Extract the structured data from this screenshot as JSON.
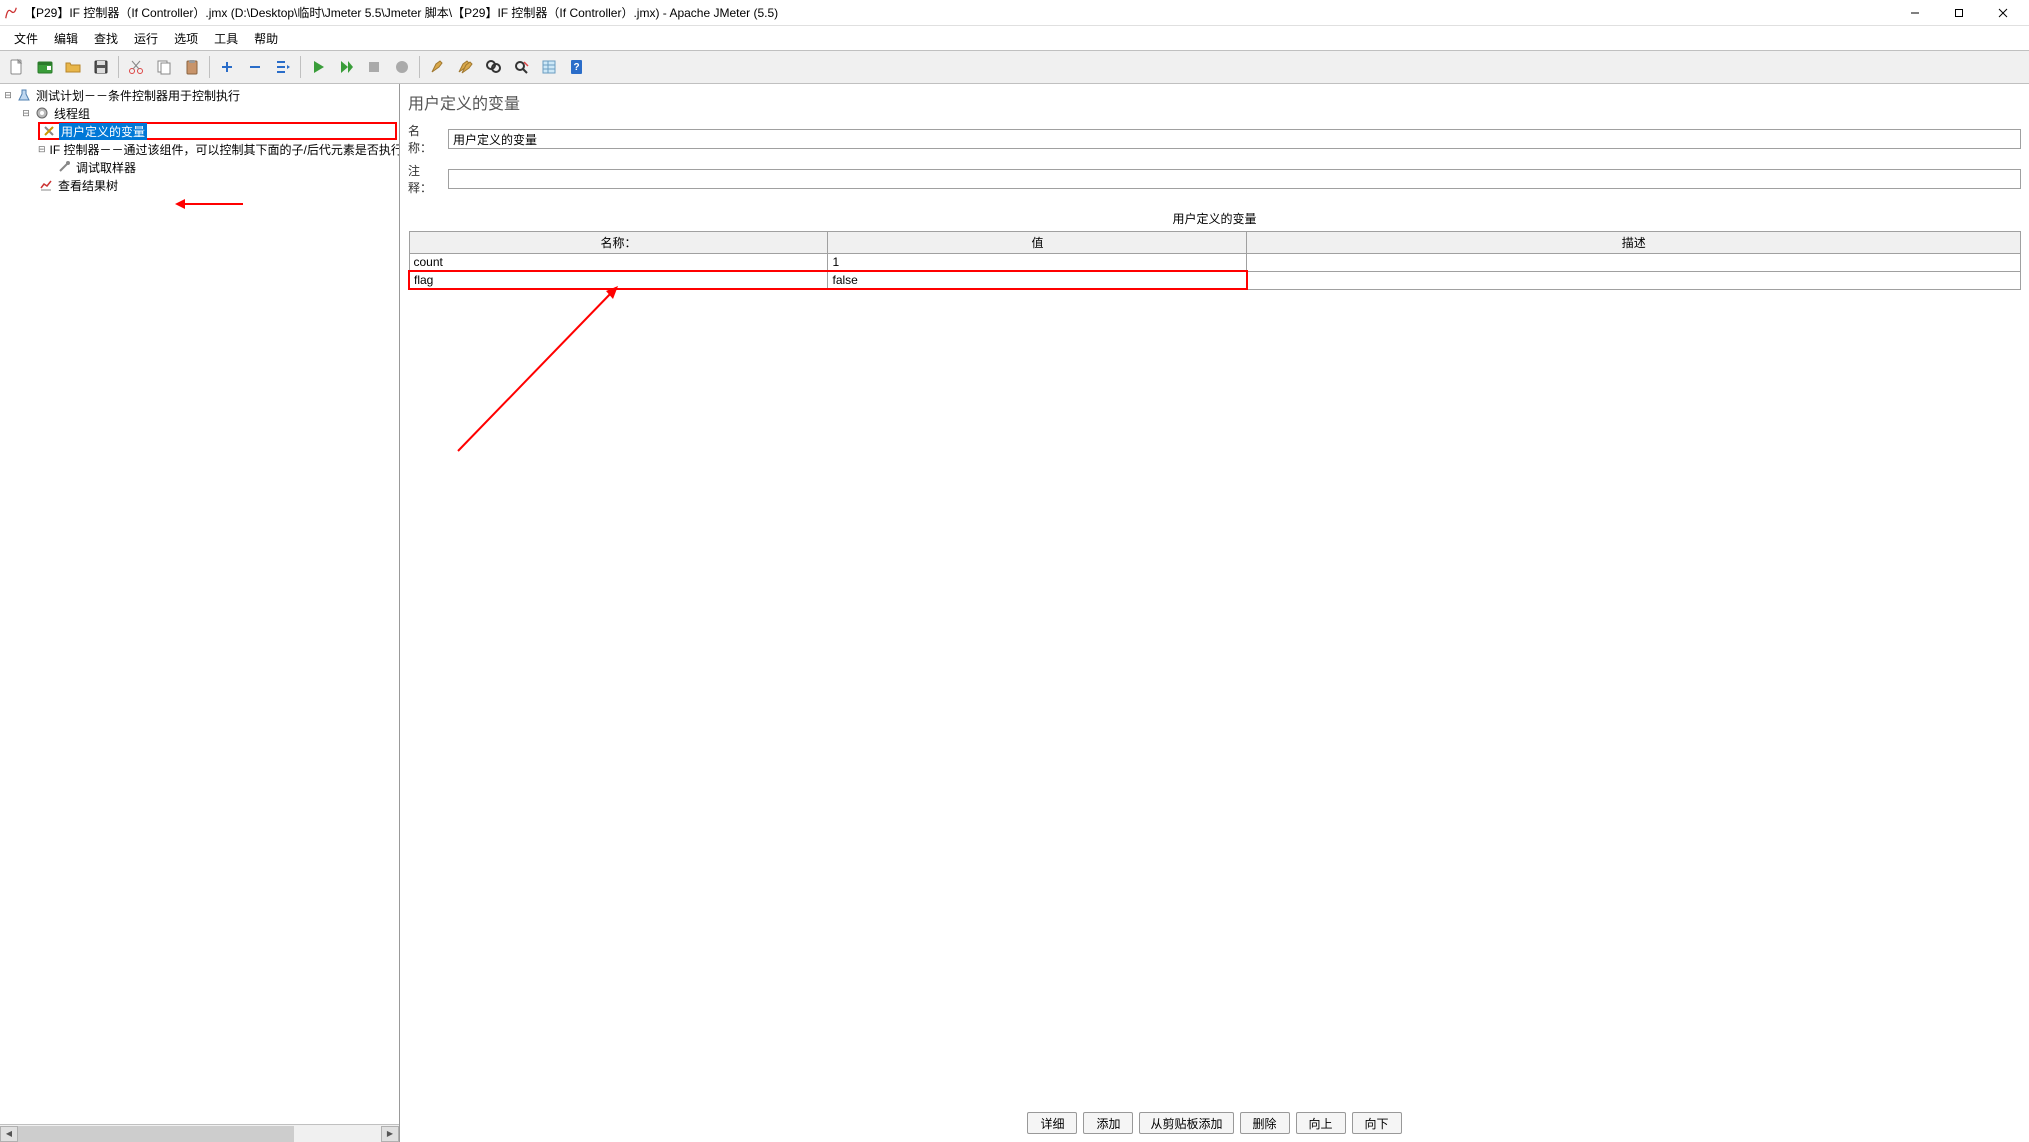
{
  "window": {
    "title": "【P29】IF 控制器（If Controller）.jmx (D:\\Desktop\\临时\\Jmeter 5.5\\Jmeter 脚本\\【P29】IF 控制器（If Controller）.jmx) - Apache JMeter (5.5)"
  },
  "menu": {
    "file": "文件",
    "edit": "编辑",
    "search": "查找",
    "run": "运行",
    "options": "选项",
    "tools": "工具",
    "help": "帮助"
  },
  "tree": {
    "root": "测试计划－－条件控制器用于控制执行",
    "threadgroup": "线程组",
    "udv": "用户定义的变量",
    "ifctrl": "IF 控制器－－通过该组件，可以控制其下面的子/后代元素是否执行",
    "debug": "调试取样器",
    "results": "查看结果树"
  },
  "panel": {
    "title": "用户定义的变量",
    "name_label": "名称：",
    "name_value": "用户定义的变量",
    "comment_label": "注释：",
    "comment_value": "",
    "section": "用户定义的变量",
    "cols": {
      "name": "名称：",
      "value": "值",
      "desc": "描述"
    },
    "rows": [
      {
        "name": "count",
        "value": "1",
        "desc": ""
      },
      {
        "name": "flag",
        "value": "false",
        "desc": ""
      }
    ]
  },
  "buttons": {
    "detail": "详细",
    "add": "添加",
    "clip": "从剪贴板添加",
    "delete": "删除",
    "up": "向上",
    "down": "向下"
  }
}
